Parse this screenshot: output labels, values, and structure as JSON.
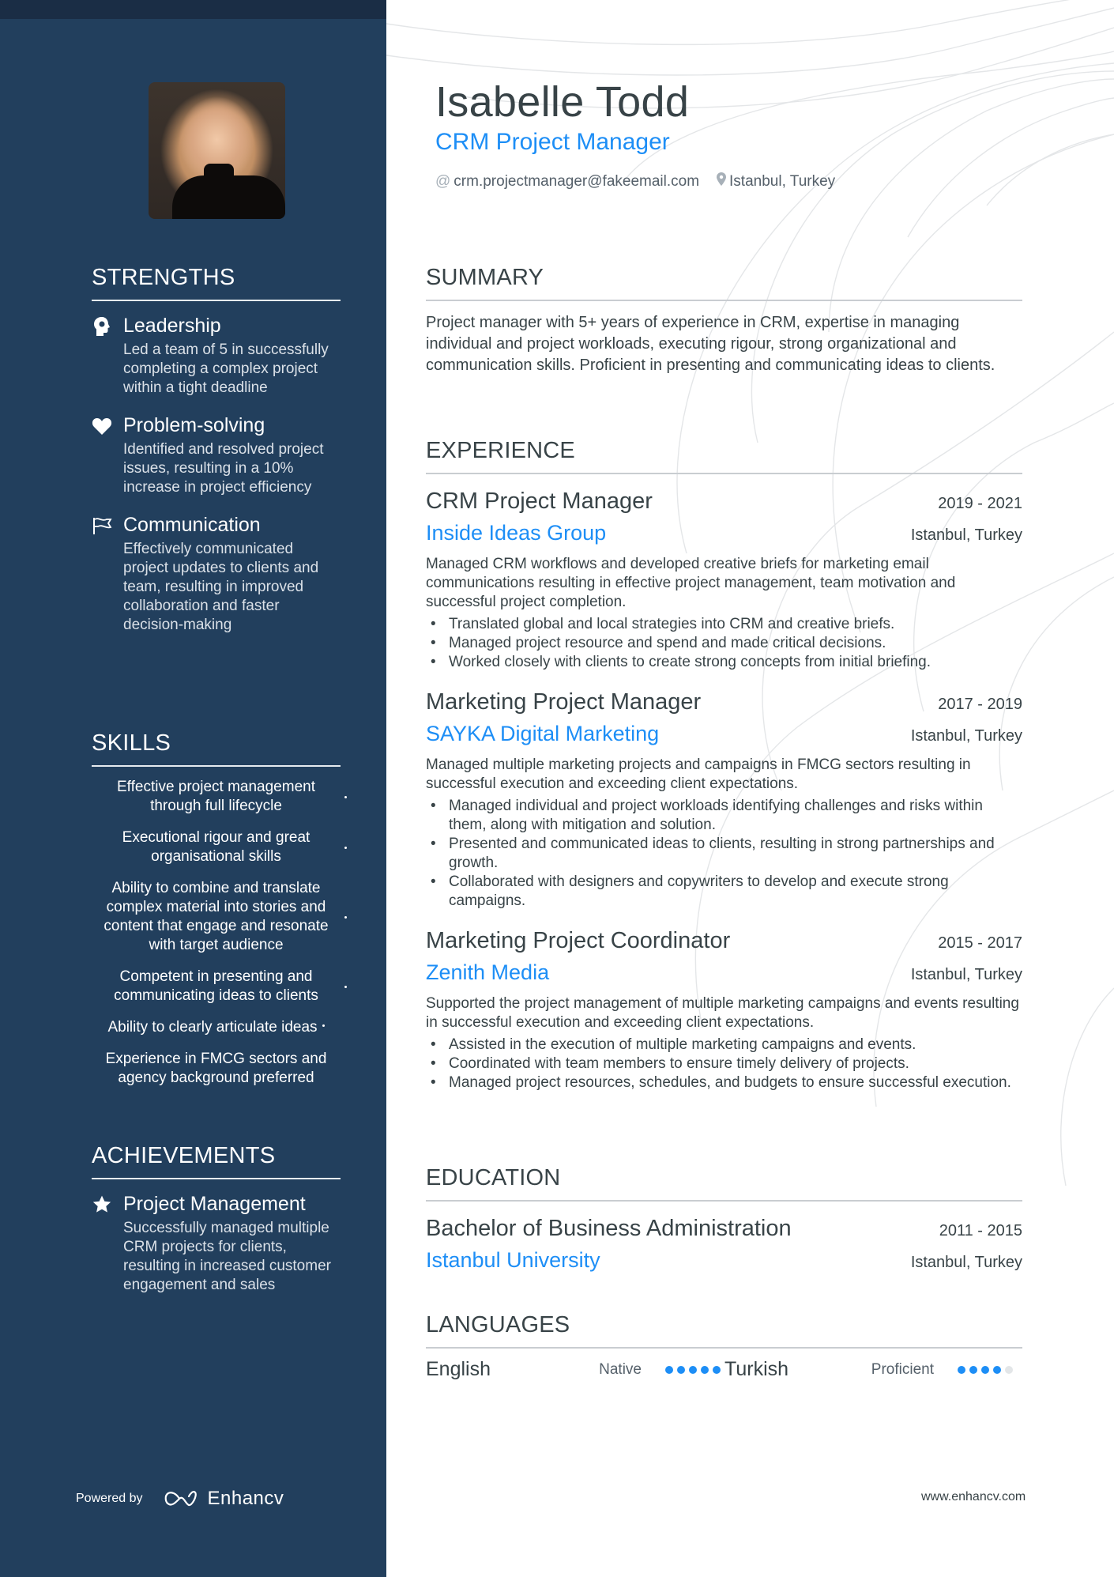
{
  "header": {
    "name": "Isabelle Todd",
    "title": "CRM Project Manager",
    "email": "crm.projectmanager@fakeemail.com",
    "location": "Istanbul, Turkey",
    "email_icon": "@",
    "location_icon": "map-pin-icon"
  },
  "colors": {
    "sidebar_bg": "#223f5d",
    "accent": "#1d8ef6",
    "text": "#384347"
  },
  "sidebar": {
    "strengths": {
      "title": "STRENGTHS",
      "items": [
        {
          "icon": "head-icon",
          "title": "Leadership",
          "desc": "Led a team of 5 in successfully completing a complex project within a tight deadline"
        },
        {
          "icon": "heart-icon",
          "title": "Problem-solving",
          "desc": "Identified and resolved project issues, resulting in a 10% increase in project efficiency"
        },
        {
          "icon": "flag-icon",
          "title": "Communication",
          "desc": "Effectively communicated project updates to clients and team, resulting in improved collaboration and faster decision-making"
        }
      ]
    },
    "skills": {
      "title": "SKILLS",
      "items": [
        "Effective project management through full lifecycle",
        "Executional rigour and great organisational skills",
        "Ability to combine and translate complex material into stories and content that engage and resonate with target audience",
        "Competent in presenting and communicating ideas to clients",
        "Ability to clearly articulate ideas",
        "Experience in FMCG sectors and agency background preferred"
      ]
    },
    "achievements": {
      "title": "ACHIEVEMENTS",
      "items": [
        {
          "icon": "star-icon",
          "title": "Project Management",
          "desc": "Successfully managed multiple CRM projects for clients, resulting in increased customer engagement and sales"
        }
      ]
    },
    "powered_by": "Powered by",
    "brand": "Enhancv"
  },
  "summary": {
    "title": "SUMMARY",
    "text": "Project manager with 5+ years of experience in CRM, expertise in managing individual and project workloads, executing rigour, strong organizational and communication skills. Proficient in presenting and communicating ideas to clients."
  },
  "experience": {
    "title": "EXPERIENCE",
    "items": [
      {
        "role": "CRM Project Manager",
        "dates": "2019 - 2021",
        "company": "Inside Ideas Group",
        "location": "Istanbul, Turkey",
        "desc": "Managed CRM workflows and developed creative briefs for marketing email communications resulting in effective project management, team motivation and successful project completion.",
        "bullets": [
          "Translated global and local strategies into CRM and creative briefs.",
          "Managed project resource and spend and made critical decisions.",
          "Worked closely with clients to create strong concepts from initial briefing."
        ]
      },
      {
        "role": "Marketing Project Manager",
        "dates": "2017 - 2019",
        "company": "SAYKA Digital Marketing",
        "location": "Istanbul, Turkey",
        "desc": "Managed multiple marketing projects and campaigns in FMCG sectors resulting in successful execution and exceeding client expectations.",
        "bullets": [
          "Managed individual and project workloads identifying challenges and risks within them, along with mitigation and solution.",
          "Presented and communicated ideas to clients, resulting in strong partnerships and growth.",
          "Collaborated with designers and copywriters to develop and execute strong campaigns."
        ]
      },
      {
        "role": "Marketing Project Coordinator",
        "dates": "2015 - 2017",
        "company": "Zenith Media",
        "location": "Istanbul, Turkey",
        "desc": "Supported the project management of multiple marketing campaigns and events resulting in successful execution and exceeding client expectations.",
        "bullets": [
          "Assisted in the execution of multiple marketing campaigns and events.",
          "Coordinated with team members to ensure timely delivery of projects.",
          "Managed project resources, schedules, and budgets to ensure successful execution."
        ]
      }
    ]
  },
  "education": {
    "title": "EDUCATION",
    "items": [
      {
        "degree": "Bachelor of Business Administration",
        "dates": "2011 - 2015",
        "school": "Istanbul University",
        "location": "Istanbul, Turkey"
      }
    ]
  },
  "languages": {
    "title": "LANGUAGES",
    "items": [
      {
        "name": "English",
        "level": "Native",
        "rating": 5,
        "max": 5
      },
      {
        "name": "Turkish",
        "level": "Proficient",
        "rating": 4,
        "max": 5
      }
    ]
  },
  "footer": {
    "url": "www.enhancv.com"
  }
}
